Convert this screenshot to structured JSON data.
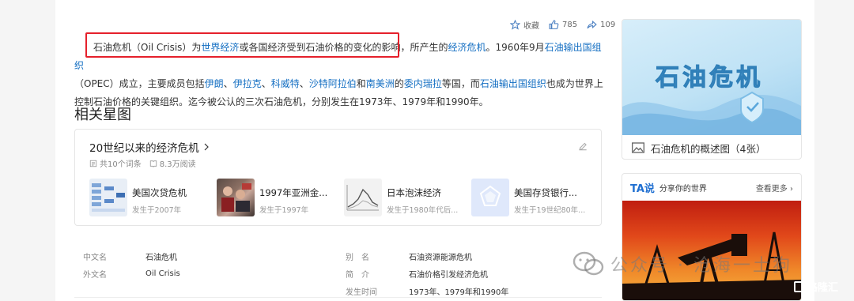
{
  "actions": {
    "favorite_label": "收藏",
    "like_count": "785",
    "share_count": "109"
  },
  "summary": {
    "s1": "石油危机（Oil Crisis）为",
    "l1": "世界经济",
    "s2": "或各国经济受到石油价格的变化的影响，所产生的",
    "l2": "经济危机",
    "s3": "。1960年9月",
    "l3": "石油输出国组织",
    "s4": "（OPEC）成立，主要成员包括",
    "l4": "伊朗",
    "s5": "、",
    "l5": "伊拉克",
    "s6": "、",
    "l6": "科威特",
    "s7": "、",
    "l7": "沙特阿拉伯",
    "s8": "和",
    "l8": "南美洲",
    "s9": "的",
    "l9": "委内瑞拉",
    "s10": "等国，而",
    "l10": "石油输出国组织",
    "s11": "也成为世界上控制石油价格的关键组织。迄今被公认的三次石油危机，分别发生在1973年、1979年和1990年。"
  },
  "related": {
    "heading": "相关星图",
    "title": "20世纪以来的经济危机",
    "count": "共10个词条",
    "reads": "8.3万阅读",
    "items": [
      {
        "name": "美国次贷危机",
        "sub": "发生于2007年"
      },
      {
        "name": "1997年亚洲金...",
        "sub": "发生于1997年"
      },
      {
        "name": "日本泡沫经济",
        "sub": "发生于1980年代后..."
      },
      {
        "name": "美国存贷银行...",
        "sub": "发生于19世纪80年..."
      }
    ]
  },
  "infobox": {
    "rows": [
      {
        "l1": "中文名",
        "v1": "石油危机",
        "l2": "别　名",
        "v2": "石油资源能源危机"
      },
      {
        "l1": "外文名",
        "v1": "Oil Crisis",
        "l2": "简　介",
        "v2": "石油价格引发经济危机"
      },
      {
        "l1": "",
        "v1": "",
        "l2": "发生时间",
        "v2": "1973年、1979年和1990年"
      }
    ]
  },
  "album": {
    "title": "石油危机",
    "caption": "石油危机的概述图（4张）"
  },
  "ta": {
    "logo": "TA说",
    "slogan": "分享你的世界",
    "more": "查看更多"
  },
  "watermark": {
    "text": "公众号 · 沧海一土狗",
    "brand": "格隆汇"
  },
  "colors": {
    "link": "#136ec2",
    "highlight": "#e5202b"
  }
}
